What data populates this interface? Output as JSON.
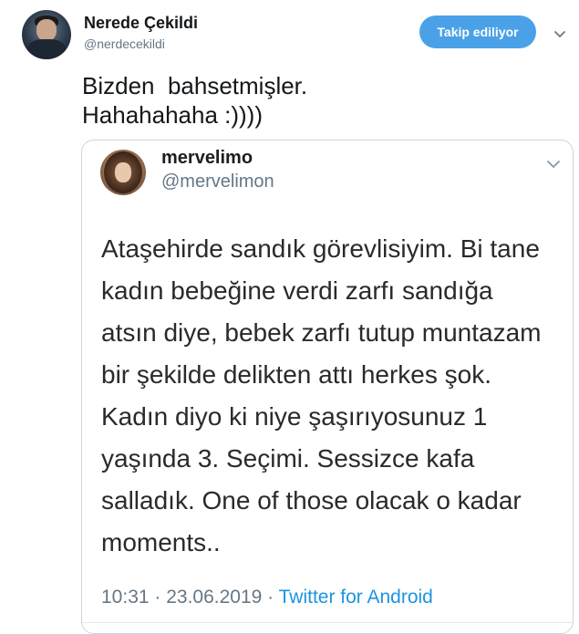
{
  "header": {
    "display_name": "Nerede Çekildi",
    "handle": "@nerdecekildi",
    "follow_button_label": "Takip ediliyor"
  },
  "tweet": {
    "lines": [
      "Bizden  bahsetmişler.",
      "Hahahahaha :))))"
    ]
  },
  "quoted_tweet": {
    "display_name": "mervelimo",
    "handle": "@mervelimon",
    "body_lines": [
      "Ataşehirde sandık görevlisiyim. Bi tane",
      "kadın bebeğine verdi zarfı sandığa",
      "atsın diye, bebek zarfı tutup muntazam",
      "bir şekilde delikten attı herkes şok.",
      "Kadın diyo ki niye şaşırıyosunuz 1",
      "yaşında 3. Seçimi. Sessizce kafa",
      "salladık. One of those olacak o kadar",
      "moments.."
    ],
    "timestamp": "10:31 · 23.06.2019 · ",
    "source": "Twitter for Android"
  },
  "icons": {
    "top_menu": "chevron-down-icon",
    "quote_menu": "chevron-down-icon"
  },
  "colors": {
    "follow_button": "#4aa1e8",
    "link": "#1b95e0",
    "secondary_text": "#657786"
  }
}
